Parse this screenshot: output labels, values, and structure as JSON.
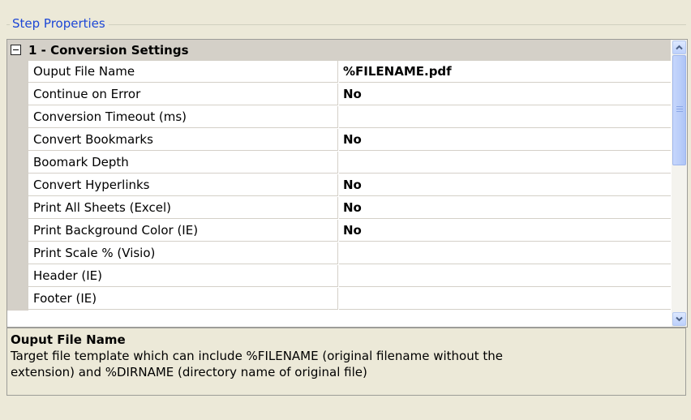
{
  "panel": {
    "title": "Step Properties"
  },
  "grid": {
    "category": {
      "label": "1 - Conversion Settings",
      "expanded": true
    },
    "properties": [
      {
        "name": "Ouput File Name",
        "value": "%FILENAME.pdf",
        "selected": true
      },
      {
        "name": "Continue on Error",
        "value": "No"
      },
      {
        "name": "Conversion Timeout (ms)",
        "value": ""
      },
      {
        "name": "Convert Bookmarks",
        "value": "No"
      },
      {
        "name": "Boomark Depth",
        "value": ""
      },
      {
        "name": "Convert Hyperlinks",
        "value": "No"
      },
      {
        "name": "Print All Sheets (Excel)",
        "value": "No"
      },
      {
        "name": "Print Background Color (IE)",
        "value": "No"
      },
      {
        "name": "Print Scale % (Visio)",
        "value": ""
      },
      {
        "name": "Header (IE)",
        "value": ""
      },
      {
        "name": "Footer (IE)",
        "value": ""
      }
    ]
  },
  "help": {
    "title": "Ouput File Name",
    "line1": "Target file template which can include %FILENAME (original filename without the",
    "line2": "extension) and %DIRNAME (directory name of original file)"
  },
  "icons": {
    "expander": "collapse-minus-icon",
    "scroll_up": "chevron-up-icon",
    "scroll_down": "chevron-down-icon"
  },
  "colors": {
    "legend_text": "#1d47d6",
    "category_bg": "#d4d0c8",
    "window_bg": "#ece9d8"
  }
}
